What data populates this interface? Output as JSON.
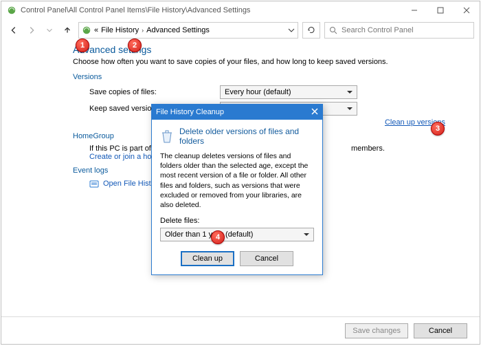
{
  "titlebar": {
    "path": "Control Panel\\All Control Panel Items\\File History\\Advanced Settings"
  },
  "breadcrumbs": {
    "a": "File History",
    "b": "Advanced Settings"
  },
  "search": {
    "placeholder": "Search Control Panel"
  },
  "heading": "Advanced settings",
  "desc": "Choose how often you want to save copies of your files, and how long to keep saved versions.",
  "groups": {
    "versions": "Versions",
    "homegroup": "HomeGroup",
    "eventlogs": "Event logs"
  },
  "versions": {
    "save_label": "Save copies of files:",
    "save_value": "Every hour (default)",
    "keep_label": "Keep saved version",
    "cleanup_link": "Clean up versions"
  },
  "homegroup": {
    "line": "If this PC is part of",
    "suffix": "members.",
    "create_link": "Create or join a ho"
  },
  "eventlogs": {
    "open_link": "Open File Hist"
  },
  "footer": {
    "save": "Save changes",
    "cancel": "Cancel"
  },
  "dialog": {
    "title": "File History Cleanup",
    "heading": "Delete older versions of files and folders",
    "body": "The cleanup deletes versions of files and folders older than the selected age, except the most recent version of a file or folder. All other files and folders, such as versions that were excluded or removed from your libraries, are also deleted.",
    "delete_label": "Delete files:",
    "delete_value": "Older than 1 year (default)",
    "cleanup_btn": "Clean up",
    "cancel_btn": "Cancel"
  },
  "badges": {
    "b1": "1",
    "b2": "2",
    "b3": "3",
    "b4": "4"
  }
}
